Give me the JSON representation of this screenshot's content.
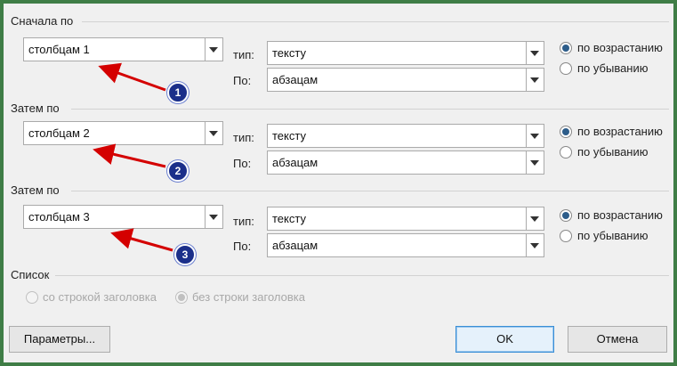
{
  "sections": [
    {
      "title": "Сначала по",
      "column_value": "столбцам 1",
      "type_label": "тип:",
      "type_value": "тексту",
      "by_label": "По:",
      "by_value": "абзацам",
      "asc_label": "по возрастанию",
      "desc_label": "по убыванию",
      "badge": "1"
    },
    {
      "title": "Затем по",
      "column_value": "столбцам 2",
      "type_label": "тип:",
      "type_value": "тексту",
      "by_label": "По:",
      "by_value": "абзацам",
      "asc_label": "по возрастанию",
      "desc_label": "по убыванию",
      "badge": "2"
    },
    {
      "title": "Затем по",
      "column_value": "столбцам 3",
      "type_label": "тип:",
      "type_value": "тексту",
      "by_label": "По:",
      "by_value": "абзацам",
      "asc_label": "по возрастанию",
      "desc_label": "по убыванию",
      "badge": "3"
    }
  ],
  "list": {
    "title": "Список",
    "with_header_label": "со строкой заголовка",
    "without_header_label": "без строки заголовка"
  },
  "buttons": {
    "params": "Параметры...",
    "ok": "OK",
    "cancel": "Отмена"
  },
  "colors": {
    "annotation_arrow": "#d40000",
    "badge_fill": "#1b2f8a",
    "radio_selected": "#2d5d8a"
  }
}
